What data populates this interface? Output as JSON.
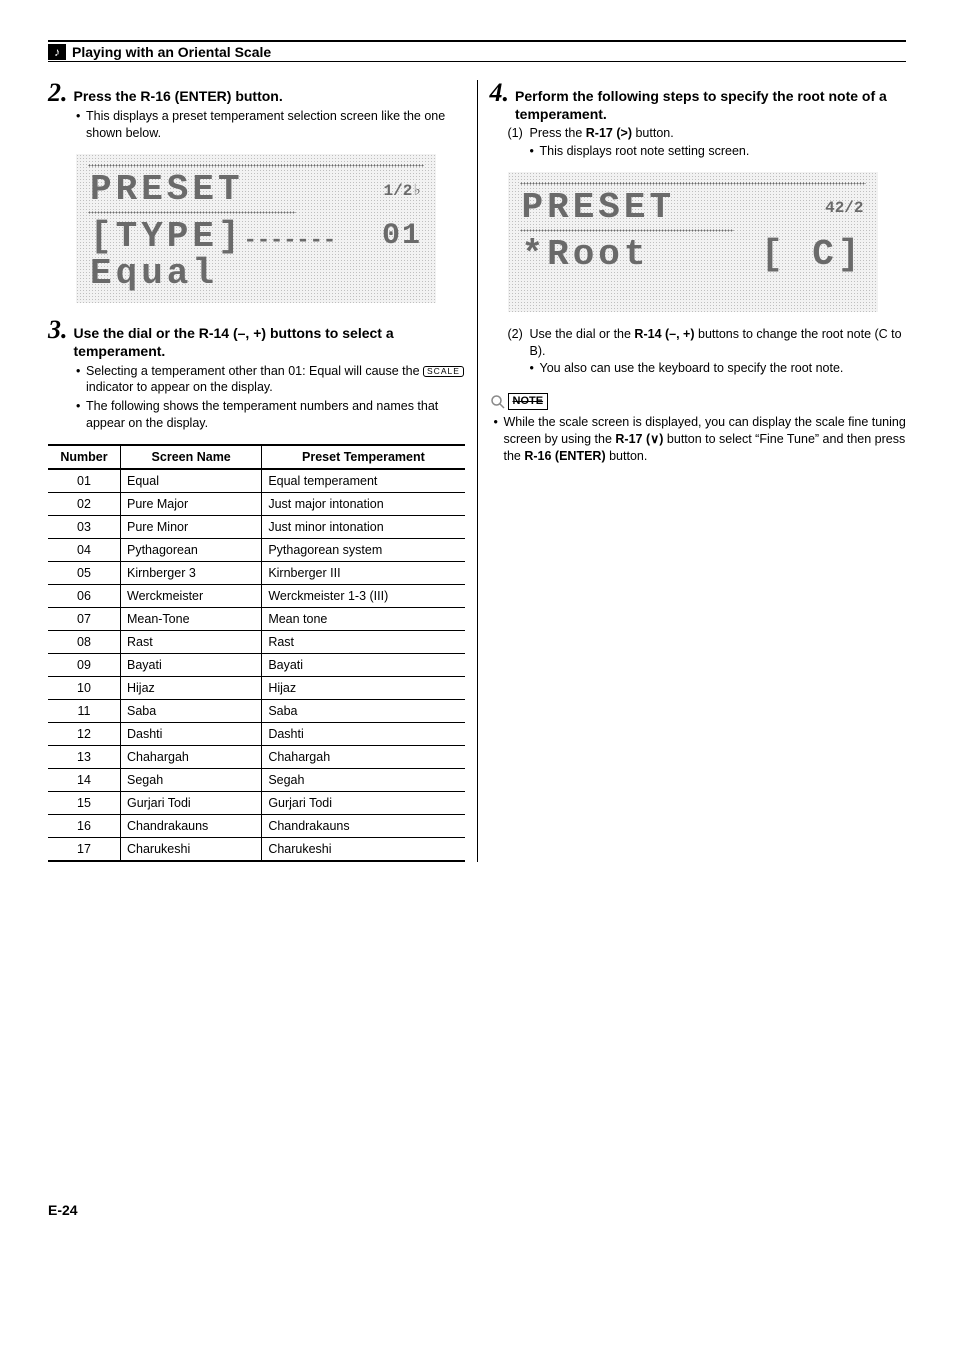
{
  "header": {
    "title": "Playing with an Oriental Scale"
  },
  "left": {
    "step2": {
      "num": "2.",
      "title": "Press the R-16 (ENTER) button.",
      "bullet1": "This displays a preset temperament selection screen like the one shown below."
    },
    "lcd1": {
      "top_left": "PRESET",
      "top_right": "1/2",
      "mid_left": "[TYPE]",
      "mid_right": "01",
      "bottom": "Equal"
    },
    "step3": {
      "num": "3.",
      "title": "Use the dial or the R-14 (–, +) buttons to select a temperament.",
      "bullet1_pre": "Selecting a temperament other than 01: Equal will cause the ",
      "bullet1_ind": "SCALE",
      "bullet1_post": " indicator to appear on the display.",
      "bullet2": "The following shows the temperament numbers and names that appear on the display."
    },
    "table": {
      "h1": "Number",
      "h2": "Screen Name",
      "h3": "Preset Temperament",
      "rows": [
        {
          "n": "01",
          "s": "Equal",
          "p": "Equal temperament"
        },
        {
          "n": "02",
          "s": "Pure Major",
          "p": "Just major intonation"
        },
        {
          "n": "03",
          "s": "Pure Minor",
          "p": "Just minor intonation"
        },
        {
          "n": "04",
          "s": "Pythagorean",
          "p": "Pythagorean system"
        },
        {
          "n": "05",
          "s": "Kirnberger 3",
          "p": "Kirnberger III"
        },
        {
          "n": "06",
          "s": "Werckmeister",
          "p": "Werckmeister 1-3 (III)"
        },
        {
          "n": "07",
          "s": "Mean-Tone",
          "p": "Mean tone"
        },
        {
          "n": "08",
          "s": "Rast",
          "p": "Rast"
        },
        {
          "n": "09",
          "s": "Bayati",
          "p": "Bayati"
        },
        {
          "n": "10",
          "s": "Hijaz",
          "p": "Hijaz"
        },
        {
          "n": "11",
          "s": "Saba",
          "p": "Saba"
        },
        {
          "n": "12",
          "s": "Dashti",
          "p": "Dashti"
        },
        {
          "n": "13",
          "s": "Chahargah",
          "p": "Chahargah"
        },
        {
          "n": "14",
          "s": "Segah",
          "p": "Segah"
        },
        {
          "n": "15",
          "s": "Gurjari Todi",
          "p": "Gurjari Todi"
        },
        {
          "n": "16",
          "s": "Chandrakauns",
          "p": "Chandrakauns"
        },
        {
          "n": "17",
          "s": "Charukeshi",
          "p": "Charukeshi"
        }
      ]
    }
  },
  "right": {
    "step4": {
      "num": "4.",
      "title": "Perform the following steps to specify the root note of a temperament.",
      "ss1_lbl": "(1)",
      "ss1_pre": "Press the ",
      "ss1_btn": "R-17 (",
      "ss1_post": ")",
      "ss1_end": " button.",
      "ss1_bullet": "This displays root note setting screen.",
      "ss2_lbl": "(2)",
      "ss2_pre": "Use the dial or the ",
      "ss2_btn": "R-14 (–, +)",
      "ss2_post": " buttons to change the root note (C to B).",
      "ss2_bullet": "You also can use the keyboard to specify the root note."
    },
    "lcd2": {
      "top_left": "PRESET",
      "top_right": "42/2",
      "mid_left": "*Root",
      "mid_right": "[  C]"
    },
    "note": {
      "label": "NOTE",
      "text_pre": "While the scale screen is displayed, you can display the scale fine tuning screen by using the ",
      "btn1": "R-17 (",
      "btn1_post": ")",
      "text_mid": " button to select “Fine Tune” and then press the ",
      "btn2": "R-16 (ENTER)",
      "text_end": " button."
    }
  },
  "footer": "E-24"
}
